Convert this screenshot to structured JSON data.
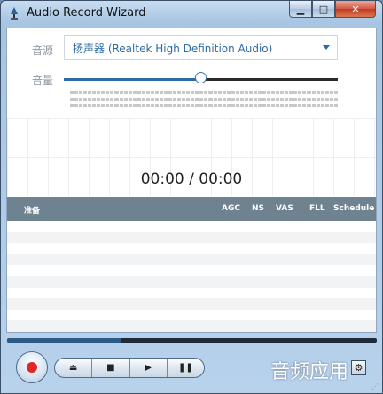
{
  "window": {
    "title": "Audio Record Wizard",
    "minimize_glyph": "▁",
    "maximize_glyph": "□",
    "close_glyph": "✕"
  },
  "source": {
    "label": "音源",
    "selected": "扬声器 (Realtek High Definition Audio)"
  },
  "volume": {
    "label": "音量",
    "level": 0.5
  },
  "timer": "00:00 / 00:00",
  "list": {
    "columns": [
      "准备",
      "AGC",
      "NS",
      "VAS",
      "FLL",
      "Schedule"
    ]
  },
  "progress": 0.31,
  "controls": {
    "eject_glyph": "⏏",
    "stop_glyph": "■",
    "play_glyph": "▶",
    "pause_glyph": "❚❚",
    "settings_glyph": "⚙"
  },
  "watermark": "音频应用",
  "colors": {
    "accent": "#2e6aa6",
    "header": "#6f8290",
    "record": "#e32626"
  }
}
